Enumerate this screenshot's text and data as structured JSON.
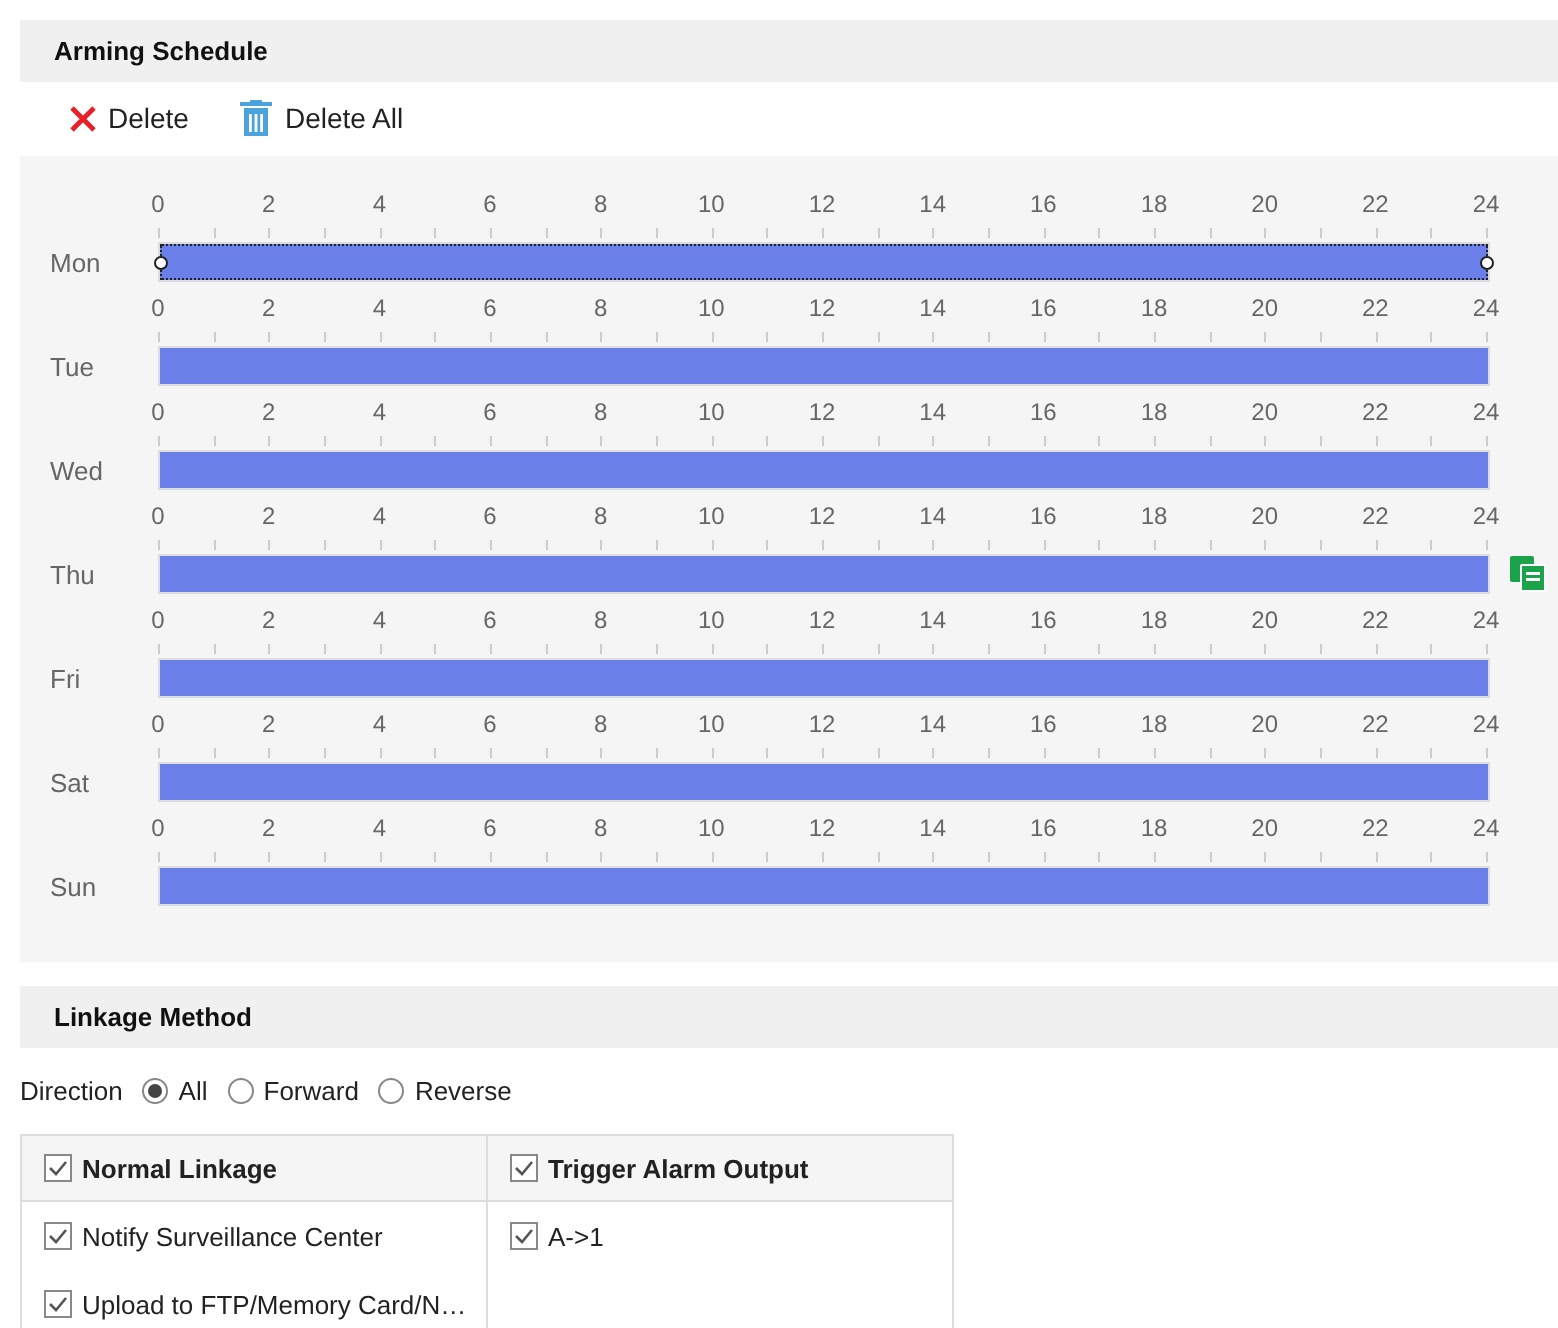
{
  "arming_schedule": {
    "title": "Arming Schedule",
    "toolbar": [
      {
        "kind": "delete",
        "label": "Delete"
      },
      {
        "kind": "delete_all",
        "label": "Delete All"
      }
    ],
    "days": [
      {
        "name": "Mon",
        "ticks": [
          "0",
          "2",
          "4",
          "6",
          "8",
          "10",
          "12",
          "14",
          "16",
          "18",
          "20",
          "22",
          "24"
        ],
        "level": 1,
        "selected": true,
        "copy_button": false
      },
      {
        "name": "Tue",
        "ticks": [
          "0",
          "2",
          "4",
          "6",
          "8",
          "10",
          "12",
          "14",
          "16",
          "18",
          "20",
          "22",
          "24"
        ],
        "level": 1,
        "selected": false,
        "copy_button": false
      },
      {
        "name": "Wed",
        "ticks": [
          "0",
          "2",
          "4",
          "6",
          "8",
          "10",
          "12",
          "14",
          "16",
          "18",
          "20",
          "22",
          "24"
        ],
        "level": 1,
        "selected": false,
        "copy_button": false
      },
      {
        "name": "Thu",
        "ticks": [
          "0",
          "2",
          "4",
          "6",
          "8",
          "10",
          "12",
          "14",
          "16",
          "18",
          "20",
          "22",
          "24"
        ],
        "level": 1,
        "selected": false,
        "copy_button": true
      },
      {
        "name": "Fri",
        "ticks": [
          "0",
          "2",
          "4",
          "6",
          "8",
          "10",
          "12",
          "14",
          "16",
          "18",
          "20",
          "22",
          "24"
        ],
        "level": 1,
        "selected": false,
        "copy_button": false
      },
      {
        "name": "Sat",
        "ticks": [
          "0",
          "2",
          "4",
          "6",
          "8",
          "10",
          "12",
          "14",
          "16",
          "18",
          "20",
          "22",
          "24"
        ],
        "level": 1,
        "selected": false,
        "copy_button": false
      },
      {
        "name": "Sun",
        "ticks": [
          "0",
          "2",
          "4",
          "6",
          "8",
          "10",
          "12",
          "14",
          "16",
          "18",
          "20",
          "22",
          "24"
        ],
        "level": 1,
        "selected": false,
        "copy_button": false
      }
    ]
  },
  "linkage_method": {
    "title": "Linkage Method",
    "direction": {
      "label": "Direction",
      "options": [
        {
          "label": "All",
          "selected": true
        },
        {
          "label": "Forward",
          "selected": false
        },
        {
          "label": "Reverse",
          "selected": false
        }
      ]
    },
    "columns": [
      {
        "header": {
          "label": "Normal Linkage",
          "checked": true
        },
        "items": [
          {
            "label": "Notify Surveillance Center",
            "checked": true
          },
          {
            "label": "Upload to FTP/Memory Card/N…",
            "checked": true
          }
        ]
      },
      {
        "header": {
          "label": "Trigger Alarm Output",
          "checked": true
        },
        "items": [
          {
            "label": "A->1",
            "checked": true
          }
        ]
      }
    ]
  }
}
